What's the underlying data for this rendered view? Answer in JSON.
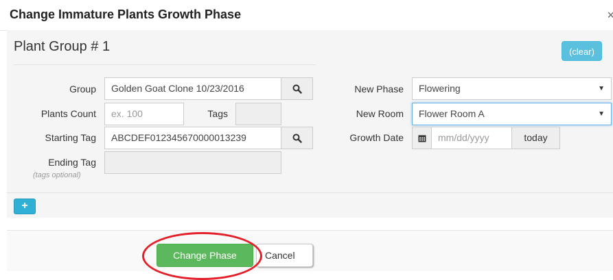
{
  "modal": {
    "title": "Change Immature Plants Growth Phase",
    "close_glyph": "×"
  },
  "group": {
    "title": "Plant Group # 1",
    "clear_label": "(clear)"
  },
  "form": {
    "group_label": "Group",
    "group_value": "Golden Goat Clone 10/23/2016",
    "plants_count_label": "Plants Count",
    "plants_count_placeholder": "ex. 100",
    "tags_label": "Tags",
    "tags_value": "",
    "starting_tag_label": "Starting Tag",
    "starting_tag_value": "ABCDEF012345670000013239",
    "ending_tag_label": "Ending Tag",
    "ending_tag_hint": "(tags optional)",
    "ending_tag_value": "",
    "new_phase_label": "New Phase",
    "new_phase_value": "Flowering",
    "new_room_label": "New Room",
    "new_room_value": "Flower Room A",
    "growth_date_label": "Growth Date",
    "growth_date_placeholder": "mm/dd/yyyy",
    "today_label": "today"
  },
  "icons": {
    "search": "search-icon",
    "calendar": "calendar-icon",
    "add": "plus-icon",
    "dropdown": "caret-down-icon"
  },
  "footer": {
    "change_phase_label": "Change Phase",
    "cancel_label": "Cancel"
  },
  "colors": {
    "clear_button": "#5bc0de",
    "add_button": "#31b0d5",
    "change_phase_button": "#5cb85c",
    "annotation_circle": "#e4202a"
  }
}
